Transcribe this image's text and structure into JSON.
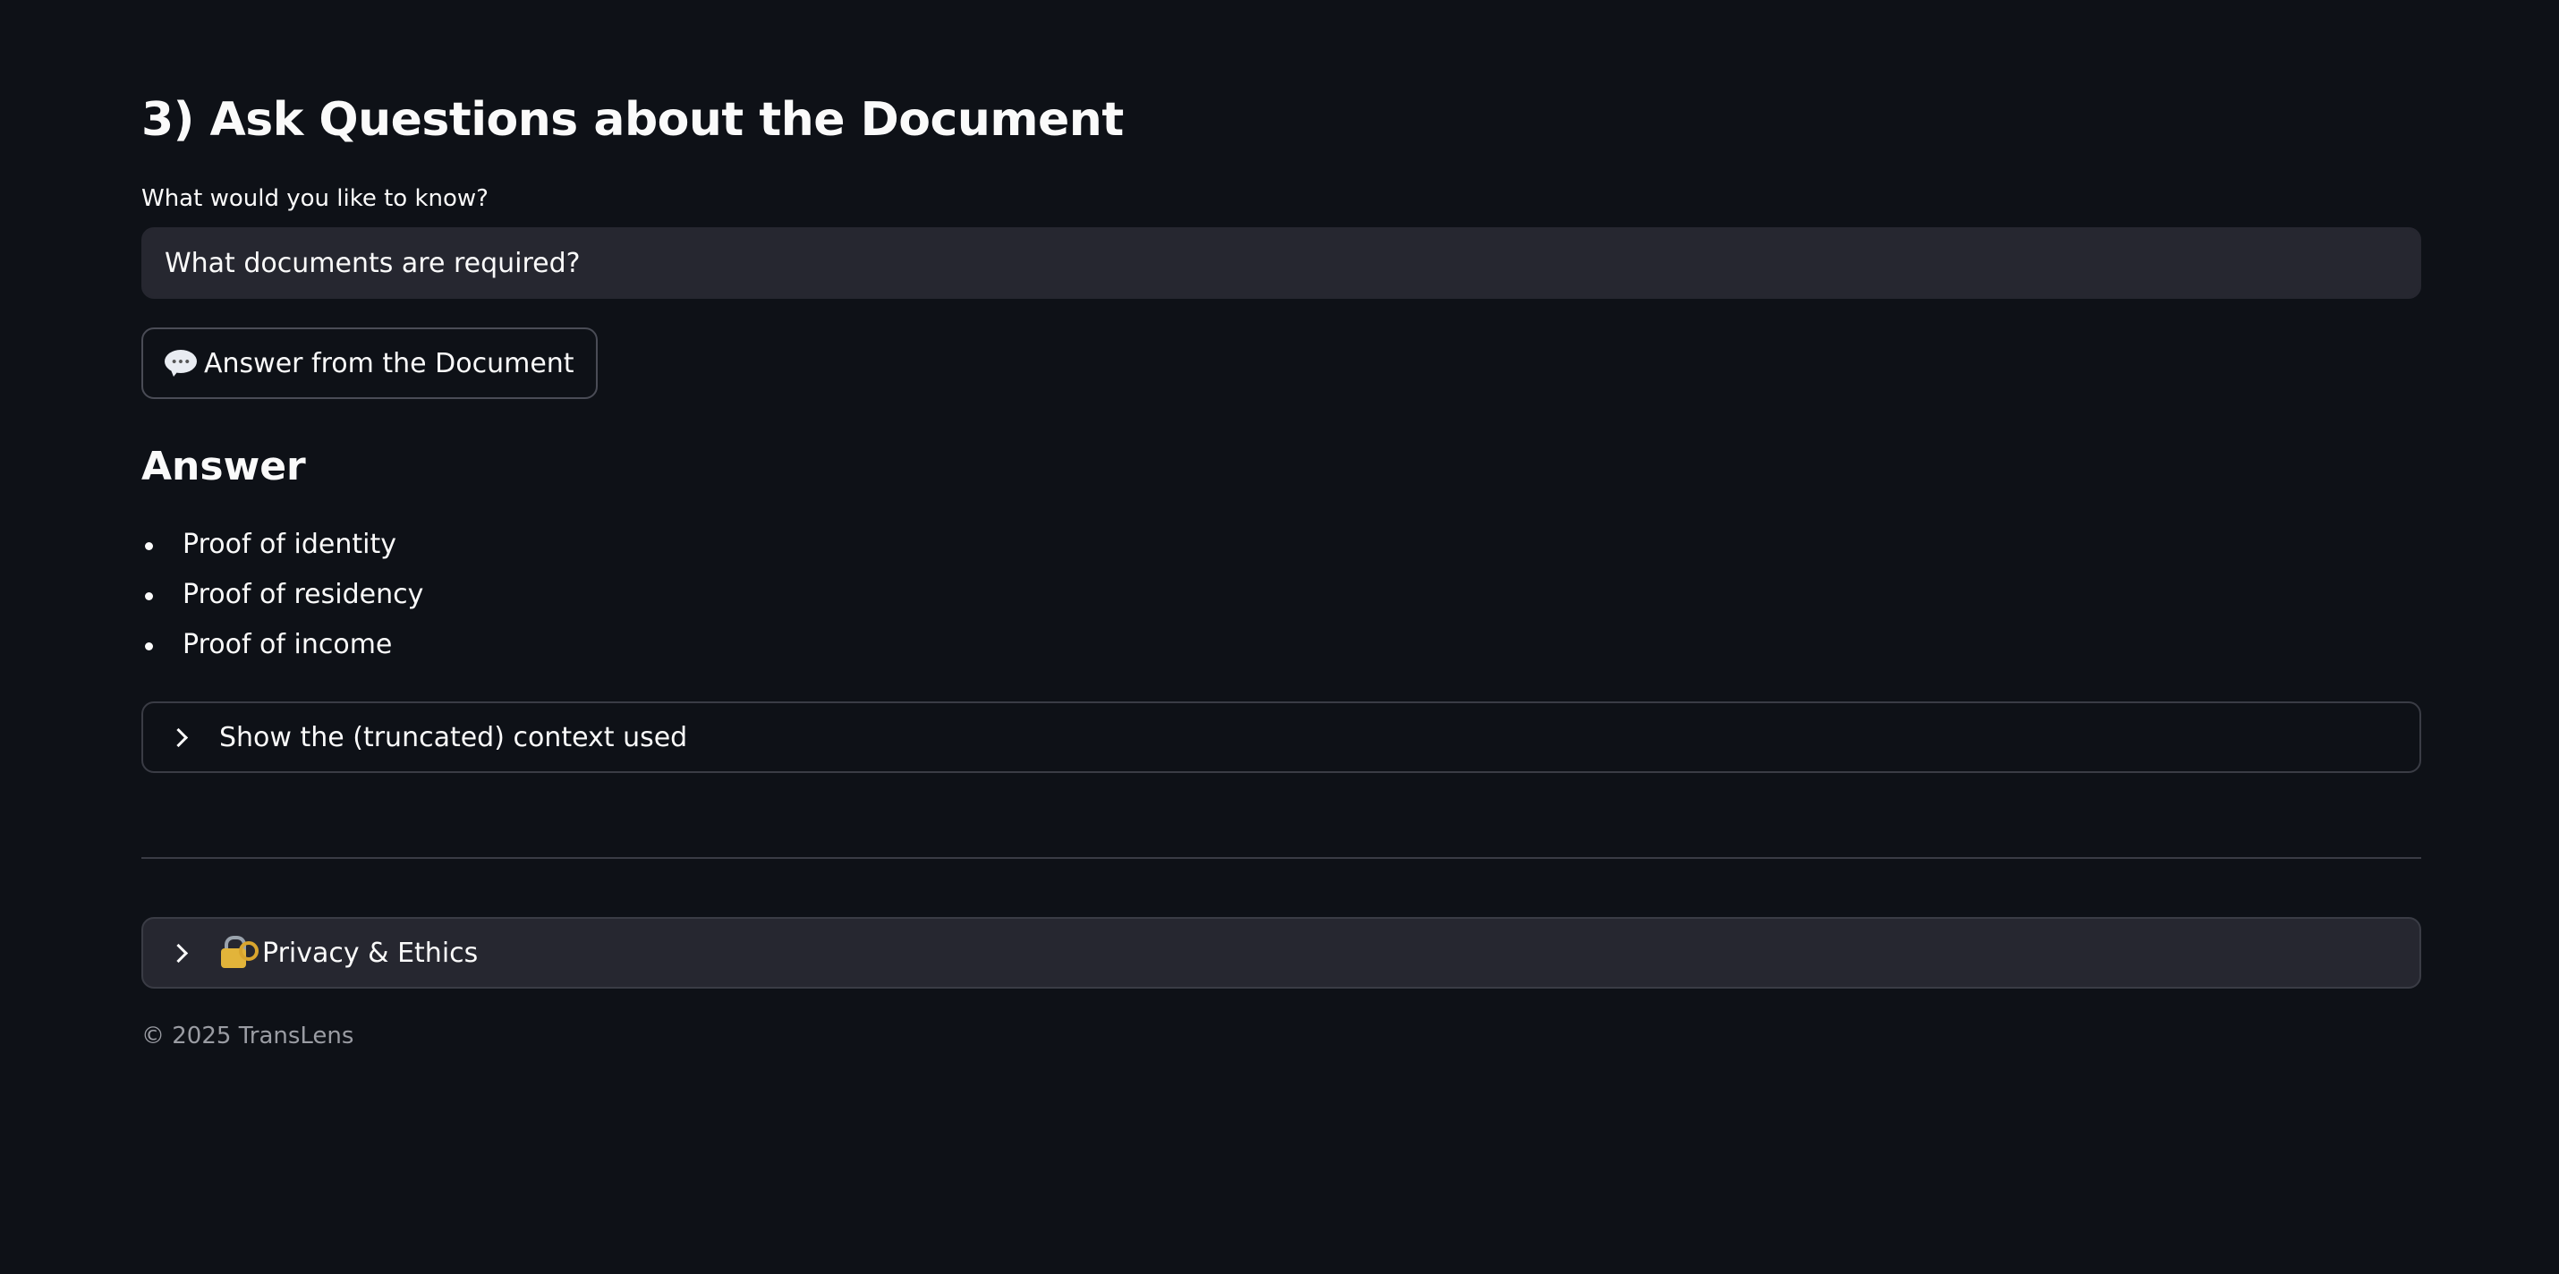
{
  "section": {
    "title": "3) Ask Questions about the Document"
  },
  "question": {
    "label": "What would you like to know?",
    "value": "What documents are required?"
  },
  "answer_button": {
    "icon": "speech-balloon-icon",
    "label": "Answer from the Document"
  },
  "answer": {
    "heading": "Answer",
    "items": [
      "Proof of identity",
      "Proof of residency",
      "Proof of income"
    ]
  },
  "context_expander": {
    "label": "Show the (truncated) context used"
  },
  "privacy_expander": {
    "icon": "lock-with-key-icon",
    "label": "Privacy & Ethics"
  },
  "footer": {
    "text": "© 2025 TransLens"
  },
  "colors": {
    "background": "#0e1117",
    "input_background": "#262730",
    "text": "#fafafa",
    "muted_text": "#9a9ca3",
    "border": "#3a3c45"
  }
}
